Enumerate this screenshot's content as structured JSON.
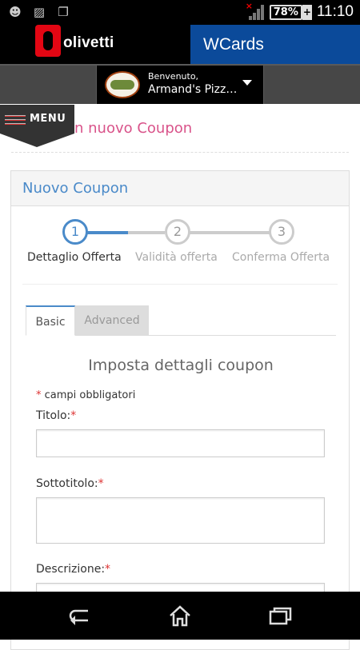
{
  "statusbar": {
    "icons": [
      "mask-icon",
      "image-icon",
      "window-icon"
    ],
    "battery": "78%",
    "time": "11:10"
  },
  "header": {
    "brand": "olivetti",
    "app_title": "WCards"
  },
  "shop_selector": {
    "welcome": "Benvenuto,",
    "shop_name": "Armand's Pizz…"
  },
  "menu": {
    "label": "MENU"
  },
  "page": {
    "title": "n nuovo Coupon"
  },
  "panel": {
    "title": "Nuovo Coupon"
  },
  "steps": [
    {
      "number": "1",
      "label": "Dettaglio Offerta",
      "active": true
    },
    {
      "number": "2",
      "label": "Validità offerta",
      "active": false
    },
    {
      "number": "3",
      "label": "Conferma Offerta",
      "active": false
    }
  ],
  "tabs": {
    "basic": "Basic",
    "advanced": "Advanced"
  },
  "form": {
    "heading": "Imposta dettagli coupon",
    "required_star": "*",
    "required_note": "campi obbligatori",
    "titolo_label": "Titolo:",
    "titolo_value": "",
    "sottotitolo_label": "Sottotitolo:",
    "sottotitolo_value": "",
    "descrizione_label": "Descrizione:",
    "descrizione_value": ""
  },
  "colors": {
    "accent_blue": "#4a8ac9",
    "header_blue": "#0b4a9a",
    "brand_red": "#e30613",
    "title_pink": "#d9538a"
  }
}
